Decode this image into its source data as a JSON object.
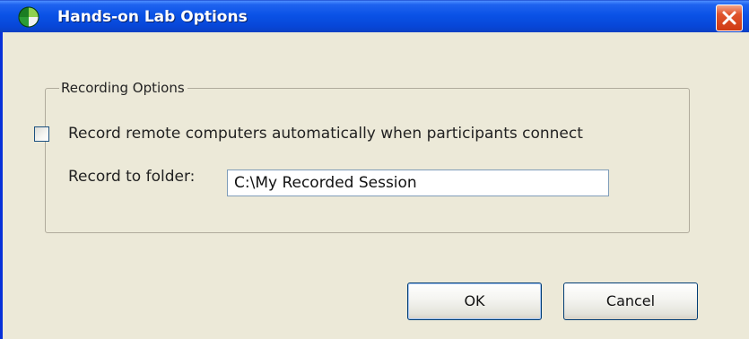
{
  "window": {
    "title": "Hands-on Lab Options",
    "app_icon": "globe-icon",
    "close_icon": "close-icon"
  },
  "recording_options": {
    "group_label": "Recording Options",
    "auto_record": {
      "label": "Record remote computers automatically when participants connect",
      "checked": false
    },
    "folder": {
      "label": "Record to folder:",
      "value": "C:\\My Recorded Session"
    }
  },
  "buttons": {
    "ok_label": "OK",
    "cancel_label": "Cancel"
  },
  "colors": {
    "titlebar": "#0a52e6",
    "dialog_background": "#ece9d8",
    "close_button": "#e0542c"
  }
}
